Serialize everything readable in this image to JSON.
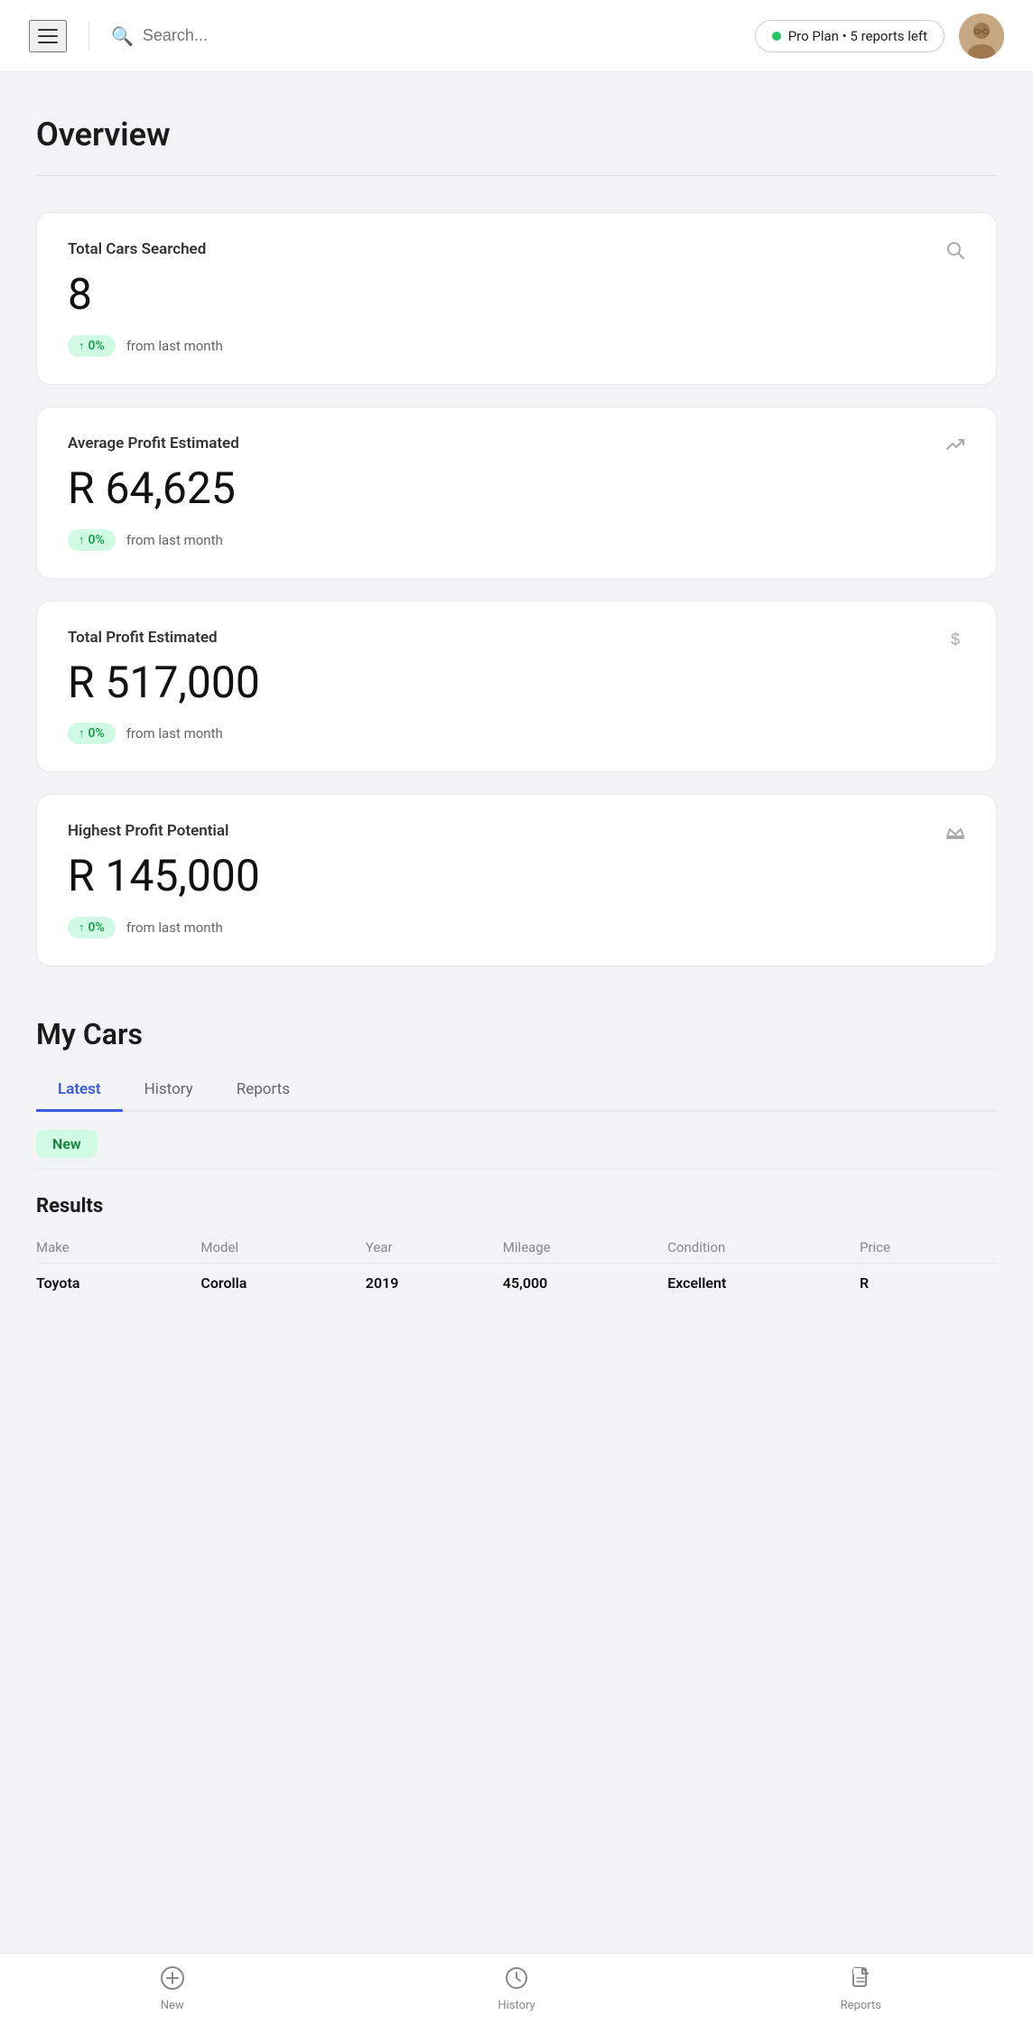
{
  "header": {
    "search_placeholder": "Search...",
    "pro_plan_label": "Pro Plan • 5 reports left",
    "pro_plan_dot_color": "#22c55e"
  },
  "page": {
    "title": "Overview"
  },
  "stats": [
    {
      "label": "Total Cars Searched",
      "value": "8",
      "change": "0%",
      "from_text": "from last month",
      "icon": "search"
    },
    {
      "label": "Average Profit Estimated",
      "value": "R 64,625",
      "change": "0%",
      "from_text": "from last month",
      "icon": "trending-up"
    },
    {
      "label": "Total Profit Estimated",
      "value": "R 517,000",
      "change": "0%",
      "from_text": "from last month",
      "icon": "dollar"
    },
    {
      "label": "Highest Profit Potential",
      "value": "R 145,000",
      "change": "0%",
      "from_text": "from last month",
      "icon": "crown"
    }
  ],
  "my_cars": {
    "section_title": "My Cars",
    "tabs": [
      {
        "label": "Latest",
        "active": true
      },
      {
        "label": "History",
        "active": false
      },
      {
        "label": "Reports",
        "active": false
      }
    ],
    "new_badge_label": "New",
    "results_title": "Results",
    "table_headers": [
      "Make",
      "Model",
      "Year",
      "Mileage",
      "Condition",
      "Price"
    ],
    "table_rows": [
      {
        "make": "Toyota",
        "model": "Corolla",
        "year": "2019",
        "mileage": "45,000",
        "condition": "Excellent",
        "price": "R"
      }
    ]
  },
  "bottom_nav": {
    "items": [
      {
        "label": "New",
        "icon": "plus",
        "active": false
      },
      {
        "label": "History",
        "icon": "clock",
        "active": false
      },
      {
        "label": "Reports",
        "icon": "file",
        "active": false
      }
    ]
  },
  "icons": {
    "search": "○",
    "trending_up": "↗",
    "dollar": "$",
    "crown": "♛",
    "hamburger": "≡",
    "plus": "+",
    "clock": "🕐",
    "file": "📄",
    "home": "⌂"
  }
}
